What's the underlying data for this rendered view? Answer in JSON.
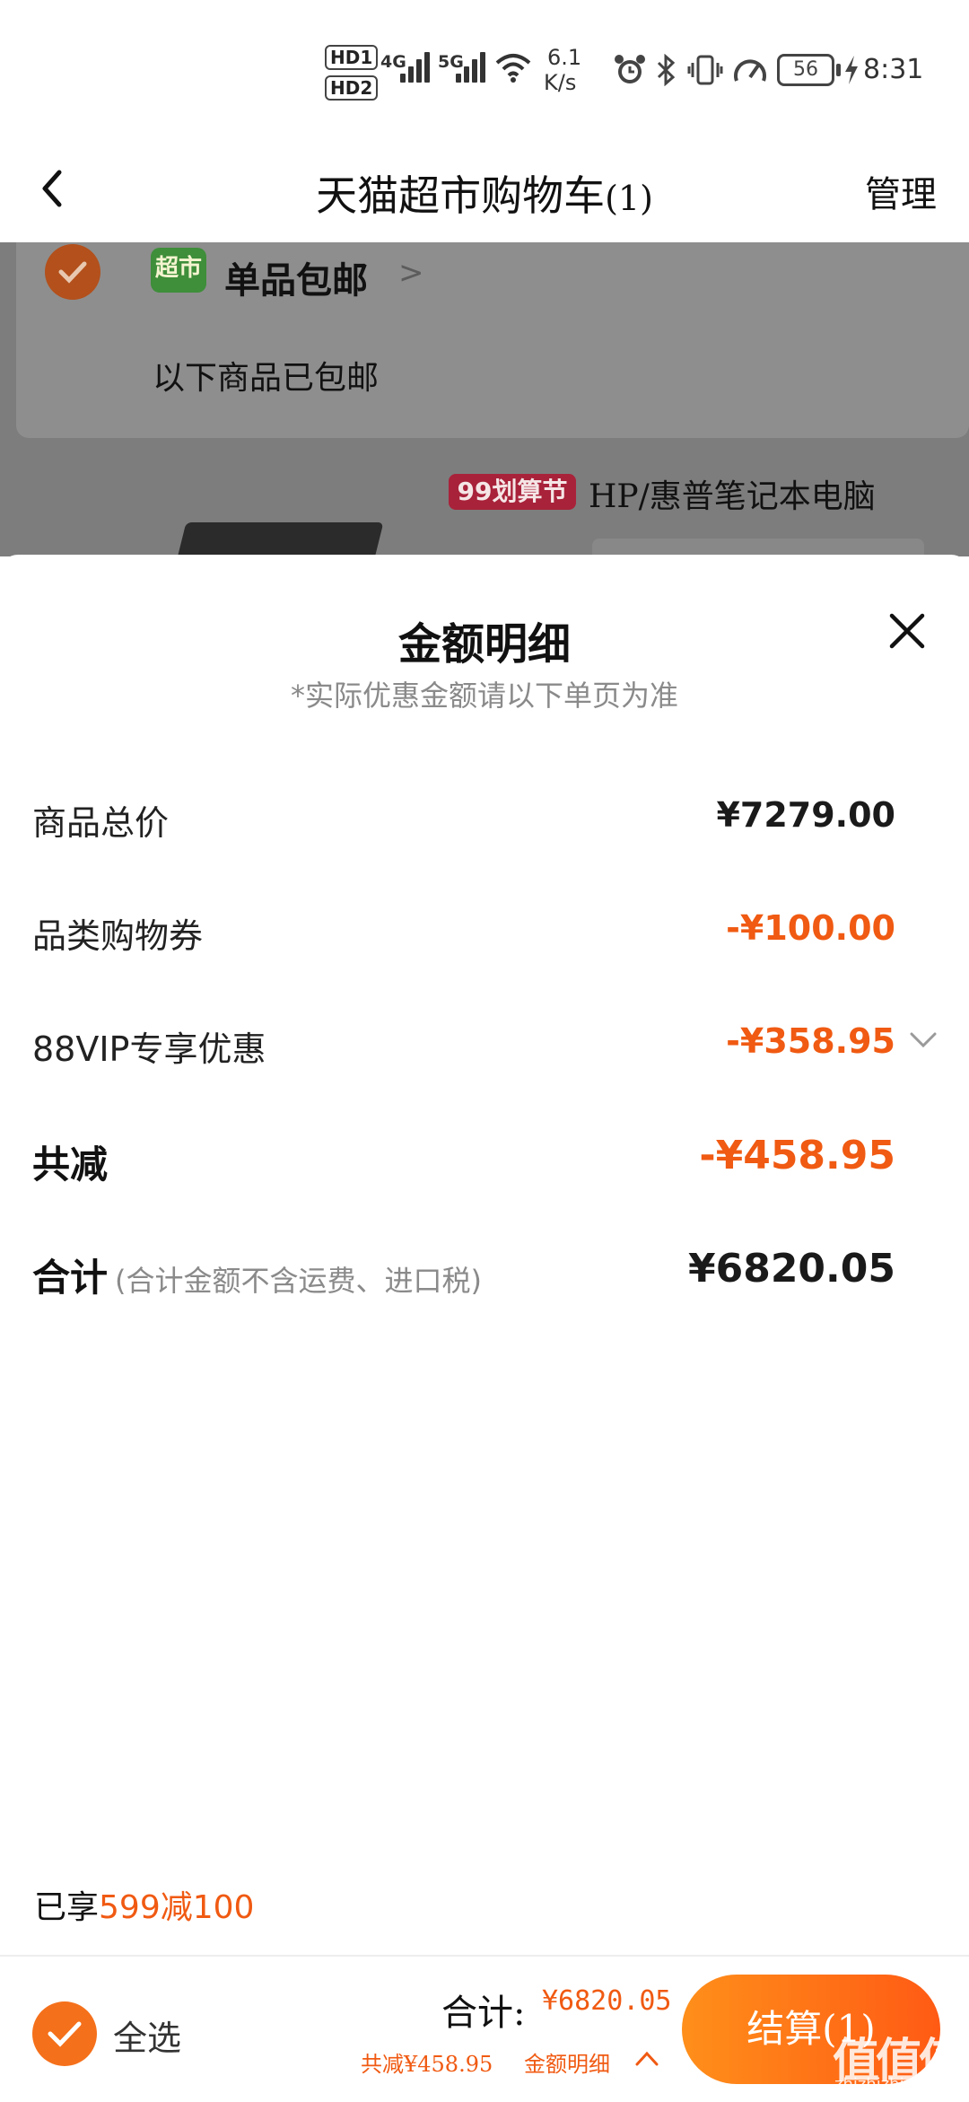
{
  "status_bar": {
    "hd1": "HD",
    "hd1_num": "1",
    "hd2": "HD",
    "hd2_num": "2",
    "net1": "4G",
    "net2": "5G",
    "speed_value": "6.1",
    "speed_unit": "K/s",
    "battery": "56",
    "time": "8:31"
  },
  "header": {
    "title": "天猫超市购物车",
    "count": "(1)",
    "manage": "管理"
  },
  "cart_background": {
    "store_logo": "超市",
    "free_shipping": "单品包邮",
    "free_shipping_arrow": ">",
    "free_shipping_sub": "以下商品已包邮",
    "promo_badge": "99划算节",
    "product_title": "HP/惠普笔记本电脑"
  },
  "sheet": {
    "title": "金额明细",
    "subtitle": "*实际优惠金额请以下单页为准",
    "rows": [
      {
        "label": "商品总价",
        "value": "¥7279.00"
      },
      {
        "label": "品类购物券",
        "value": "-¥100.00"
      },
      {
        "label": "88VIP专享优惠",
        "value": "-¥358.95"
      },
      {
        "label": "共减",
        "value": "-¥458.95"
      },
      {
        "label": "合计",
        "note": "(合计金额不含运费、进口税)",
        "value": "¥6820.05"
      }
    ],
    "enjoyed_prefix": "已享",
    "enjoyed_promo": "599减100"
  },
  "bottom_bar": {
    "select_all": "全选",
    "total_label": "合计:",
    "total_amount": "¥6820.05",
    "discount": "共减¥458.95",
    "detail_link": "金额明细",
    "checkout": "结算(1)"
  },
  "watermark": {
    "logo": "值值值",
    "site": "zhizhizhi.com"
  },
  "colors": {
    "accent": "#f05a12",
    "checkout_start": "#ff8f1a",
    "checkout_end": "#ff5a14"
  }
}
